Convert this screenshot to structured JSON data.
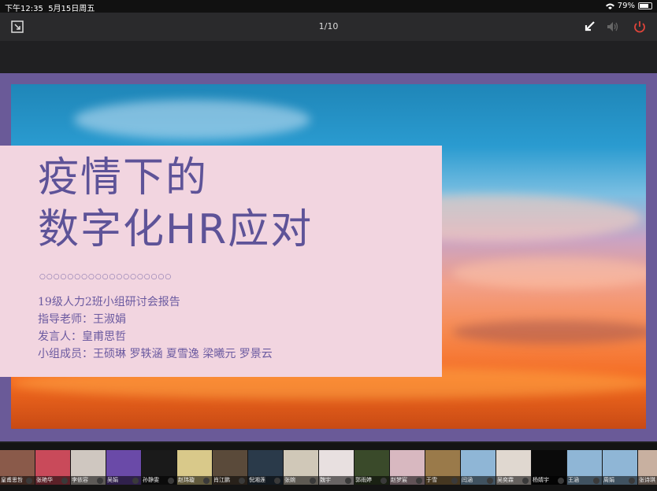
{
  "status": {
    "time": "下午12:35",
    "date": "5月15日周五",
    "battery": "79%"
  },
  "toolbar": {
    "page_indicator": "1/10"
  },
  "slide": {
    "title_line1": "疫情下的",
    "title_line2": "数字化HR应对",
    "dots": "○○○○○○○○○○○○○○○○○○○",
    "line1": "19级人力2班小组研讨会报告",
    "line2": "指导老师：王淑娟",
    "line3": "发言人：皇甫思哲",
    "line4": "小组成员：王硕琳 罗轶涵 夏雪逸 梁曦元 罗景云"
  },
  "participants": [
    {
      "name": "皇甫思哲",
      "color": "#8a5a4a"
    },
    {
      "name": "张艳华",
      "color": "#c94a5a"
    },
    {
      "name": "李依容",
      "color": "#cfc7c0"
    },
    {
      "name": "吴娟",
      "color": "#6a4aa8"
    },
    {
      "name": "孙静雯",
      "color": "#1a1a1a"
    },
    {
      "name": "赵玮璇",
      "color": "#d9c98a"
    },
    {
      "name": "肖江鹏",
      "color": "#5a4a3a"
    },
    {
      "name": "倪湘莲",
      "color": "#2a3a4a"
    },
    {
      "name": "张婉",
      "color": "#d0c8b8"
    },
    {
      "name": "魏宇",
      "color": "#e8e0e0"
    },
    {
      "name": "郭雨婷",
      "color": "#3a4a2a"
    },
    {
      "name": "赵梦宸",
      "color": "#d8b8c0"
    },
    {
      "name": "于雪",
      "color": "#9a7a4a"
    },
    {
      "name": "闫涵",
      "color": "#8fb6d6"
    },
    {
      "name": "吴奕霖",
      "color": "#e0d8d0"
    },
    {
      "name": "杨婧宇",
      "color": "#0a0a0a"
    },
    {
      "name": "王涵",
      "color": "#8fb6d6"
    },
    {
      "name": "周娟",
      "color": "#8fb6d6"
    },
    {
      "name": "张诗琪",
      "color": "#c8b0a0"
    }
  ]
}
